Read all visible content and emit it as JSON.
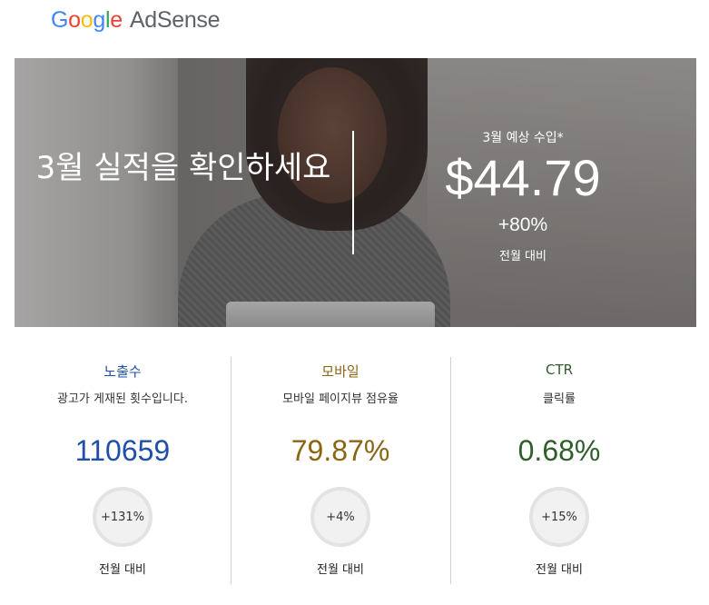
{
  "brand": {
    "google_letters": [
      "G",
      "o",
      "o",
      "g",
      "l",
      "e"
    ],
    "product": "AdSense"
  },
  "hero": {
    "title": "3월 실적을 확인하세요",
    "estimate_label": "3월 예상 수입*",
    "amount": "$44.79",
    "change": "+80%",
    "compare": "전월 대비"
  },
  "metrics": [
    {
      "title": "노출수",
      "description": "광고가 게재된 횟수입니다.",
      "value": "110659",
      "change": "+131%",
      "compare": "전월 대비",
      "color": "#1f4fa8"
    },
    {
      "title": "모바일",
      "description": "모바일 페이지뷰 점유율",
      "value": "79.87%",
      "change": "+4%",
      "compare": "전월 대비",
      "color": "#8a6514"
    },
    {
      "title": "CTR",
      "description": "클릭률",
      "value": "0.68%",
      "change": "+15%",
      "compare": "전월 대비",
      "color": "#2e5e2a"
    }
  ]
}
